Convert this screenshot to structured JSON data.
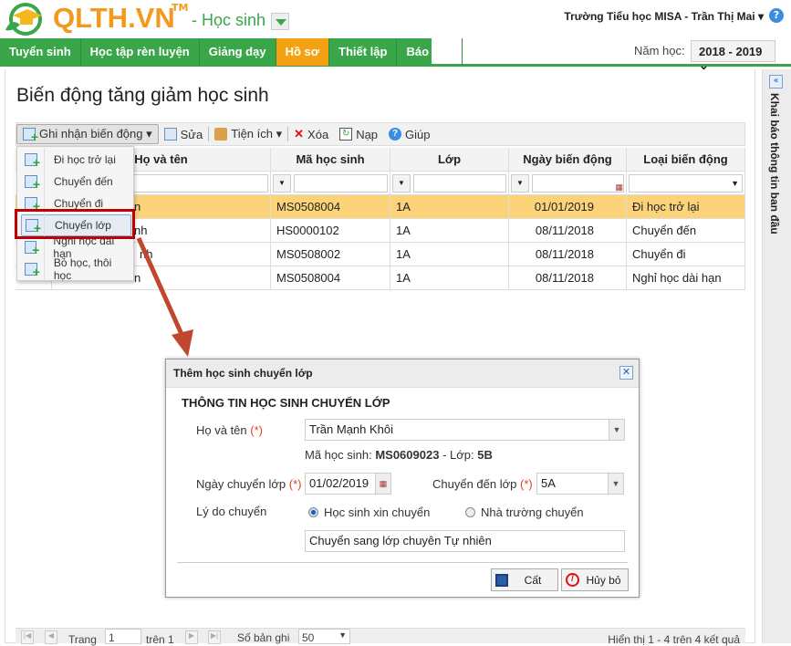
{
  "header": {
    "logo": "QLTH.VN",
    "tm": "TM",
    "module": "- Học sinh",
    "user": "Trường Tiểu học MISA - Trần Thị Mai ▾",
    "help": "?",
    "year_label": "Năm học:",
    "year_value": "2018 - 2019 ⌄"
  },
  "nav": [
    "Tuyển sinh",
    "Học tập rèn luyện",
    "Giảng dạy",
    "Hồ sơ",
    "Thiết lập",
    "Báo cáo"
  ],
  "nav_active": "Hồ sơ",
  "side_panel": {
    "collapse": "«",
    "label": "Khai báo thông tin ban đầu"
  },
  "page": {
    "title": "Biến động tăng giảm học sinh"
  },
  "toolbar": {
    "record": "Ghi nhận biến động ▾",
    "edit": "Sửa",
    "utils": "Tiện ích ▾",
    "delete": "Xóa",
    "reload": "Nạp",
    "help": "Giúp"
  },
  "grid": {
    "columns": [
      "",
      "Họ và tên",
      "Mã học sinh",
      "Lớp",
      "Ngày biến động",
      "Loại biến động"
    ],
    "rows": [
      {
        "name": "n",
        "code": "MS0508004",
        "class": "1A",
        "date": "01/01/2019",
        "type": "Đi học trở lại"
      },
      {
        "name": "nh",
        "code": "HS0000102",
        "class": "1A",
        "date": "08/11/2018",
        "type": "Chuyển đến"
      },
      {
        "name": "nh",
        "code": "MS0508002",
        "class": "1A",
        "date": "08/11/2018",
        "type": "Chuyển đi"
      },
      {
        "name": "n",
        "code": "MS0508004",
        "class": "1A",
        "date": "08/11/2018",
        "type": "Nghỉ học dài hạn"
      }
    ]
  },
  "menu": [
    "Đi học trở lại",
    "Chuyển đến",
    "Chuyển đi",
    "Chuyển lớp",
    "Nghỉ học dài hạn",
    "Bỏ học, thôi học"
  ],
  "dialog": {
    "title": "Thêm học sinh chuyển lớp",
    "close": "✕",
    "section": "THÔNG TIN HỌC SINH CHUYỂN LỚP",
    "name_label": "Họ và tên",
    "req": "(*)",
    "name_value": "Trần Mạnh Khôi",
    "code_label": "Mã học sinh:",
    "code_value": "MS0609023",
    "class_label": "- Lớp:",
    "class_value": "5B",
    "date_label": "Ngày chuyển lớp",
    "date_value": "01/02/2019",
    "to_label": "Chuyển đến lớp",
    "to_value": "5A",
    "reason_label": "Lý do chuyển",
    "opt1": "Học sinh xin chuyển",
    "opt2": "Nhà trường chuyển",
    "reason_text": "Chuyển sang lớp chuyên Tự nhiên",
    "save": "Cất",
    "cancel": "Hủy bỏ"
  },
  "pager": {
    "page_label": "Trang",
    "page": "1",
    "of": "trên 1",
    "size_label": "Số bản ghi",
    "size": "50",
    "summary": "Hiển thị 1 - 4 trên 4 kết quả"
  },
  "colors": {
    "green": "#3aa64a",
    "orange": "#f4a213",
    "selected_row": "#fdd37a",
    "highlight": "#c00000"
  }
}
